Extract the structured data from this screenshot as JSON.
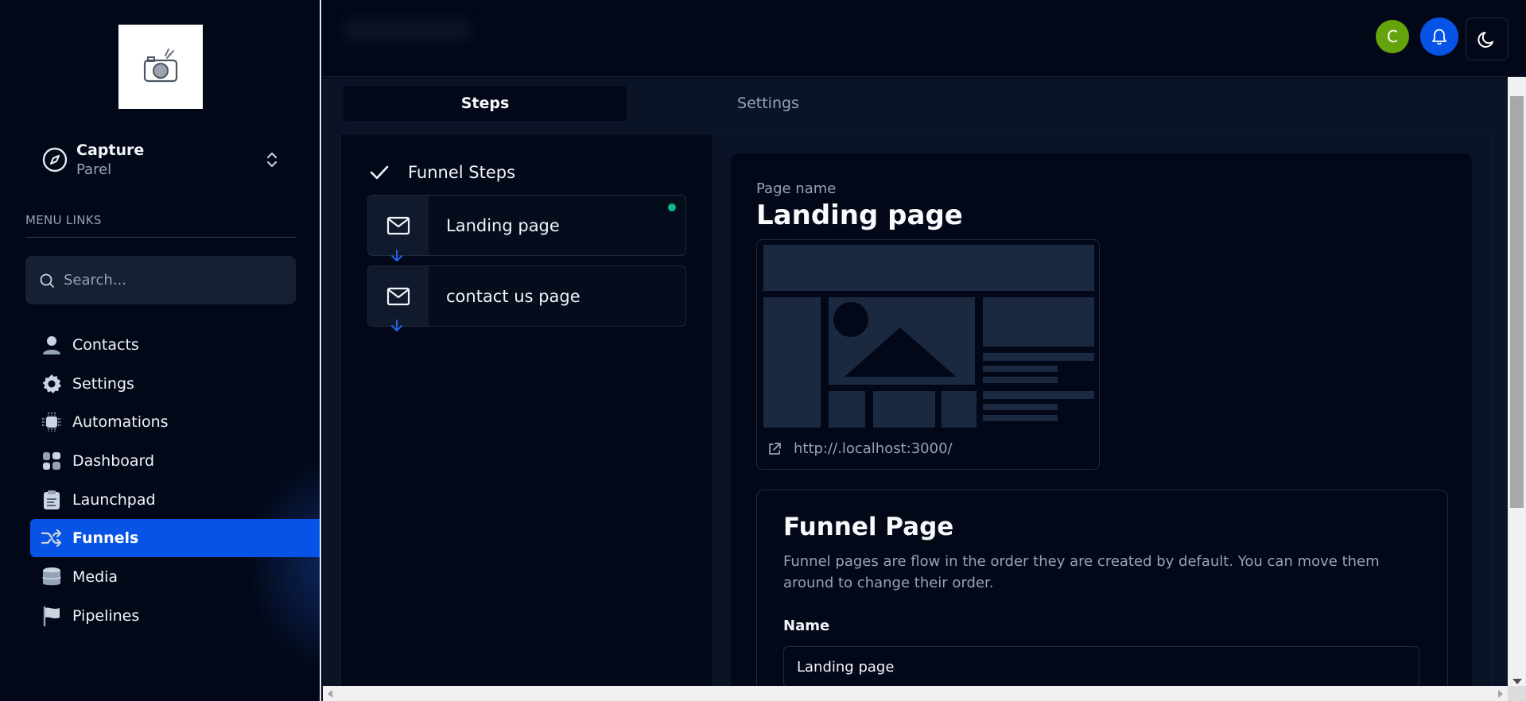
{
  "account": {
    "name": "Capture",
    "subtitle": "Parel"
  },
  "sidebar": {
    "menu_label": "MENU LINKS",
    "search_placeholder": "Search...",
    "items": [
      {
        "label": "Contacts",
        "icon": "person-icon"
      },
      {
        "label": "Settings",
        "icon": "gear-icon"
      },
      {
        "label": "Automations",
        "icon": "chip-icon"
      },
      {
        "label": "Dashboard",
        "icon": "grid-icon"
      },
      {
        "label": "Launchpad",
        "icon": "clipboard-icon"
      },
      {
        "label": "Funnels",
        "icon": "shuffle-icon",
        "active": true
      },
      {
        "label": "Media",
        "icon": "database-icon"
      },
      {
        "label": "Pipelines",
        "icon": "flag-icon"
      }
    ]
  },
  "header": {
    "avatar_initial": "C"
  },
  "tabs": [
    {
      "label": "Steps",
      "active": true
    },
    {
      "label": "Settings",
      "active": false
    }
  ],
  "steps": {
    "header": "Funnel Steps",
    "items": [
      {
        "label": "Landing page",
        "active_dot": true
      },
      {
        "label": "contact us page",
        "active_dot": false
      }
    ]
  },
  "details": {
    "page_name_label": "Page name",
    "page_name": "Landing page",
    "preview_url": "http://.localhost:3000/",
    "funnel_title": "Funnel Page",
    "funnel_description": "Funnel pages are flow in the order they are created by default. You can move them around to change their order.",
    "name_label": "Name",
    "name_value": "Landing page"
  },
  "colors": {
    "accent": "#0753e5",
    "avatar_bg": "#65a30d",
    "status_dot": "#10b981",
    "background": "#020817"
  }
}
